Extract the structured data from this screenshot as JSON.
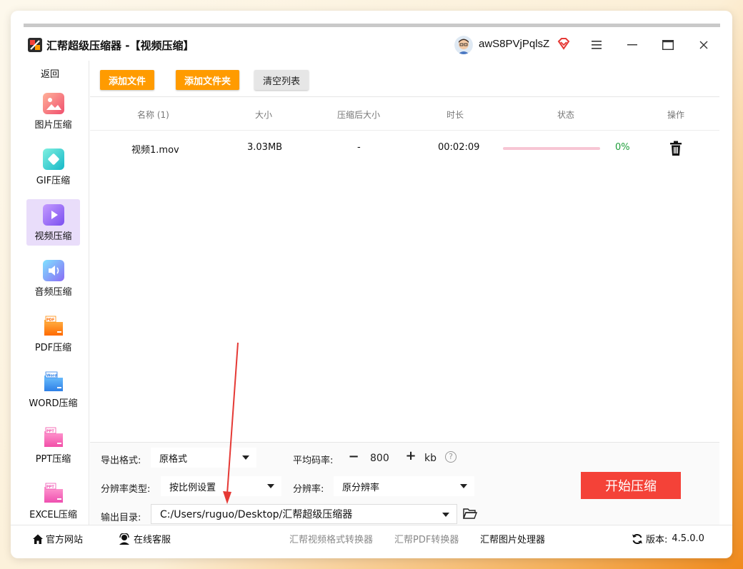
{
  "window": {
    "title": "汇帮超级压缩器 -【视频压缩】",
    "username": "awS8PVjPqlsZ"
  },
  "sidebar": {
    "back_label": "返回",
    "items": [
      {
        "label": "图片压缩",
        "icon": "image-compress-icon"
      },
      {
        "label": "GIF压缩",
        "icon": "gif-compress-icon"
      },
      {
        "label": "视频压缩",
        "icon": "video-compress-icon",
        "active": true
      },
      {
        "label": "音频压缩",
        "icon": "audio-compress-icon"
      },
      {
        "label": "PDF压缩",
        "icon": "pdf-compress-icon"
      },
      {
        "label": "WORD压缩",
        "icon": "word-compress-icon"
      },
      {
        "label": "PPT压缩",
        "icon": "ppt-compress-icon"
      },
      {
        "label": "EXCEL压缩",
        "icon": "excel-compress-icon"
      }
    ]
  },
  "toolbar": {
    "add_file": "添加文件",
    "add_folder": "添加文件夹",
    "clear_list": "清空列表"
  },
  "table": {
    "headers": {
      "name": "名称 (1)",
      "size": "大小",
      "compressed_size": "压缩后大小",
      "duration": "时长",
      "status": "状态",
      "action": "操作"
    },
    "rows": [
      {
        "name": "视频1.mov",
        "size": "3.03MB",
        "compressed_size": "-",
        "duration": "00:02:09",
        "progress": 0,
        "progress_text": "0%"
      }
    ]
  },
  "settings": {
    "export_format_label": "导出格式:",
    "export_format_value": "原格式",
    "bitrate_label": "平均码率:",
    "bitrate_value": "800",
    "bitrate_unit": "kb",
    "resolution_type_label": "分辨率类型:",
    "resolution_type_value": "按比例设置",
    "resolution_label": "分辨率:",
    "resolution_value": "原分辨率",
    "output_dir_label": "输出目录:",
    "output_dir_value": "C:/Users/ruguo/Desktop/汇帮超级压缩器",
    "start_button": "开始压缩"
  },
  "footer": {
    "website": "官方网站",
    "support": "在线客服",
    "video_converter": "汇帮视频格式转换器",
    "pdf_converter": "汇帮PDF转换器",
    "image_processor": "汇帮图片处理器",
    "version_label": "版本:",
    "version_value": "4.5.0.0"
  },
  "colors": {
    "accent_orange": "#ff9b00",
    "start_red": "#f44238",
    "active_nav": "#e9ddfa",
    "progress_pink": "#f7c6d4",
    "percent_green": "#1e9e3a",
    "annotation_arrow": "#e53935"
  }
}
